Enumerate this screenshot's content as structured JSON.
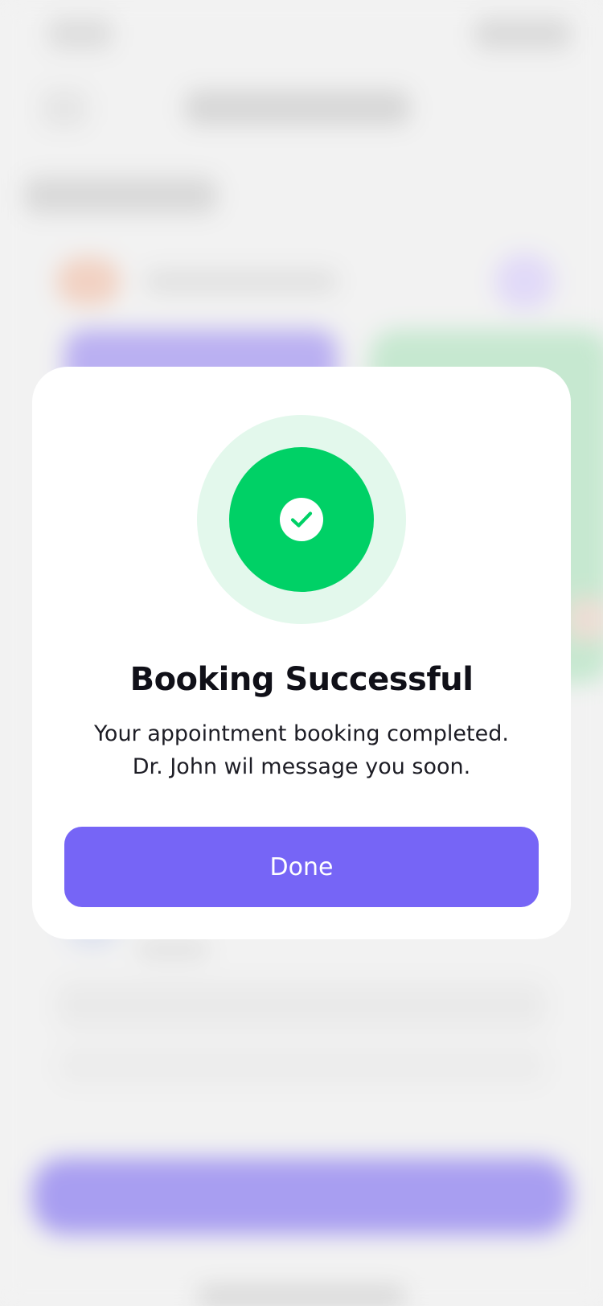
{
  "dialog": {
    "title": "Booking Successful",
    "message_line1": "Your appointment booking completed.",
    "message_line2": "Dr. John wil message you soon.",
    "done_label": "Done",
    "status_icon": "check-icon"
  },
  "colors": {
    "accent": "#7665F6",
    "success": "#00D166",
    "success_halo": "#E3F8EC",
    "title_text": "#101018",
    "card_background": "#FFFFFF"
  }
}
